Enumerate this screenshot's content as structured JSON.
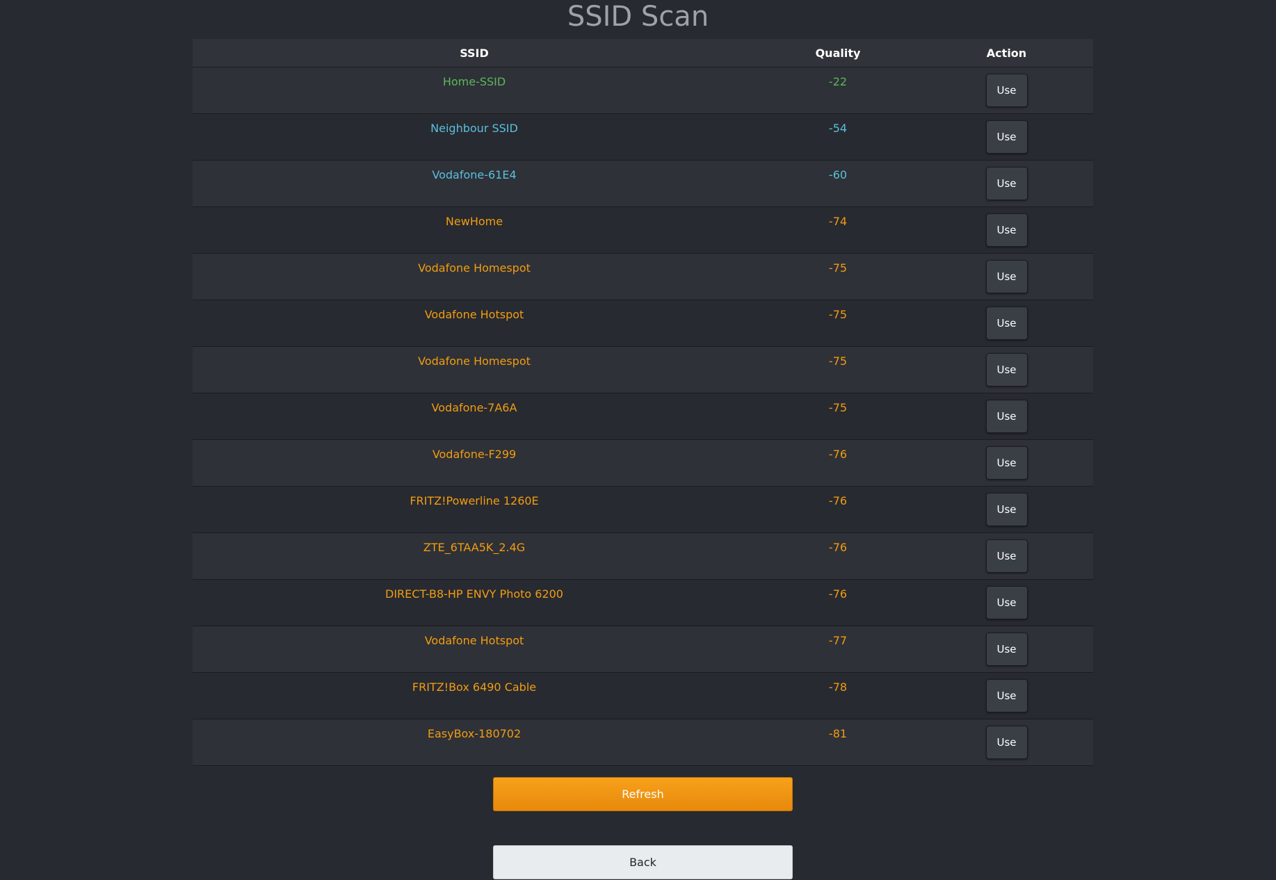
{
  "page": {
    "title": "SSID Scan"
  },
  "table": {
    "headers": {
      "ssid": "SSID",
      "quality": "Quality",
      "action": "Action"
    },
    "rows": [
      {
        "ssid": "Home-SSID",
        "quality": "-22",
        "action": "Use",
        "signal": "good"
      },
      {
        "ssid": "Neighbour SSID",
        "quality": "-54",
        "action": "Use",
        "signal": "ok"
      },
      {
        "ssid": "Vodafone-61E4",
        "quality": "-60",
        "action": "Use",
        "signal": "ok"
      },
      {
        "ssid": "NewHome",
        "quality": "-74",
        "action": "Use",
        "signal": "weak"
      },
      {
        "ssid": "Vodafone Homespot",
        "quality": "-75",
        "action": "Use",
        "signal": "weak"
      },
      {
        "ssid": "Vodafone Hotspot",
        "quality": "-75",
        "action": "Use",
        "signal": "weak"
      },
      {
        "ssid": "Vodafone Homespot",
        "quality": "-75",
        "action": "Use",
        "signal": "weak"
      },
      {
        "ssid": "Vodafone-7A6A",
        "quality": "-75",
        "action": "Use",
        "signal": "weak"
      },
      {
        "ssid": "Vodafone-F299",
        "quality": "-76",
        "action": "Use",
        "signal": "weak"
      },
      {
        "ssid": "FRITZ!Powerline 1260E",
        "quality": "-76",
        "action": "Use",
        "signal": "weak"
      },
      {
        "ssid": "ZTE_6TAA5K_2.4G",
        "quality": "-76",
        "action": "Use",
        "signal": "weak"
      },
      {
        "ssid": "DIRECT-B8-HP ENVY Photo 6200",
        "quality": "-76",
        "action": "Use",
        "signal": "weak"
      },
      {
        "ssid": "Vodafone Hotspot",
        "quality": "-77",
        "action": "Use",
        "signal": "weak"
      },
      {
        "ssid": "FRITZ!Box 6490 Cable",
        "quality": "-78",
        "action": "Use",
        "signal": "weak"
      },
      {
        "ssid": "EasyBox-180702",
        "quality": "-81",
        "action": "Use",
        "signal": "weak"
      }
    ]
  },
  "buttons": {
    "refresh": "Refresh",
    "back": "Back"
  },
  "colors": {
    "background": "#272a30",
    "signal_good": "#5cb85c",
    "signal_ok": "#5bc0de",
    "signal_weak": "#f39c12",
    "refresh_button": "#f39c12",
    "back_button": "#e9ecef"
  }
}
